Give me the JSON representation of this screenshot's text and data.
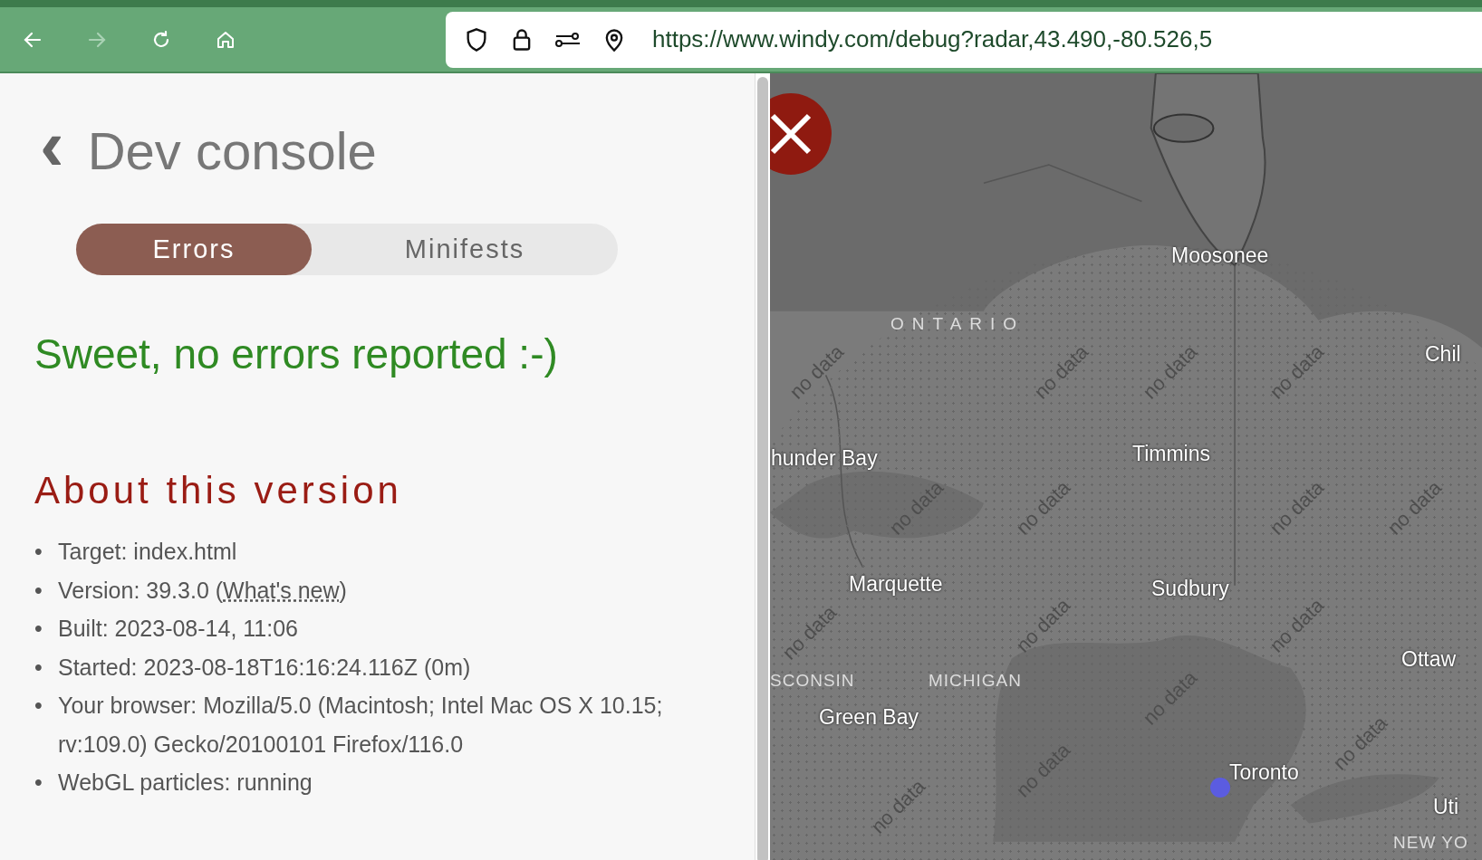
{
  "toolbar": {
    "nav_buttons": [
      {
        "kind": "back",
        "disabled": false
      },
      {
        "kind": "forward",
        "disabled": true
      },
      {
        "kind": "reload",
        "disabled": false
      },
      {
        "kind": "home",
        "disabled": false
      }
    ],
    "url": "https://www.windy.com/debug?radar,43.490,-80.526,5"
  },
  "panel": {
    "back_glyph": "‹",
    "title": "Dev console",
    "tabs": [
      {
        "label": "Errors",
        "selected": true
      },
      {
        "label": "Minifests",
        "selected": false
      }
    ],
    "status_message": "Sweet, no errors reported :-)",
    "section_title": "About this version",
    "bullet": "•",
    "info_items": [
      {
        "text": "Target: index.html"
      },
      {
        "text": "Version: 39.3.0 (",
        "link": "What's new",
        "after": ")"
      },
      {
        "text": "Built: 2023-08-14, 11:06"
      },
      {
        "text": "Started: 2023-08-18T16:16:24.116Z (0m)"
      },
      {
        "text": "Your browser: Mozilla/5.0 (Macintosh; Intel Mac OS X 10.15; rv:109.0) Gecko/20100101 Firefox/116.0"
      },
      {
        "text": "WebGL particles: running"
      }
    ]
  },
  "map": {
    "labels": [
      {
        "text": "ONTARIO",
        "kind": "region"
      },
      {
        "text": "Moosonee",
        "kind": "city"
      },
      {
        "text": "Chil",
        "kind": "city"
      },
      {
        "text": "hunder Bay",
        "kind": "city"
      },
      {
        "text": "Timmins",
        "kind": "city"
      },
      {
        "text": "Marquette",
        "kind": "city"
      },
      {
        "text": "Sudbury",
        "kind": "city"
      },
      {
        "text": "Ottaw",
        "kind": "city"
      },
      {
        "text": "SCONSIN",
        "kind": "region"
      },
      {
        "text": "MICHIGAN",
        "kind": "region"
      },
      {
        "text": "Green Bay",
        "kind": "city"
      },
      {
        "text": "Toronto",
        "kind": "city"
      },
      {
        "text": "Uti",
        "kind": "city"
      },
      {
        "text": "NEW YO",
        "kind": "region"
      }
    ],
    "overlay_texts": [
      "no data",
      "no data",
      "no data",
      "no data",
      "no data",
      "no data",
      "no data",
      "no data",
      "no data",
      "no data",
      "no data",
      "no data",
      "no data",
      "no data",
      "no data"
    ]
  }
}
